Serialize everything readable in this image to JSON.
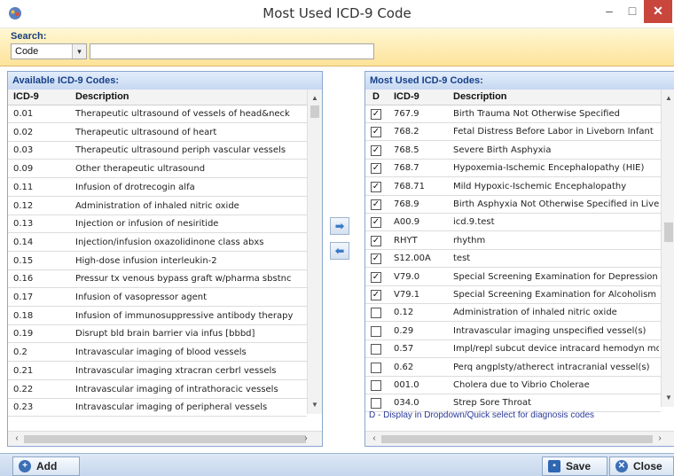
{
  "window": {
    "title": "Most Used ICD-9 Code",
    "minimize": "–",
    "maximize": "□",
    "close": "✕"
  },
  "search": {
    "label": "Search:",
    "field_value": "Code",
    "dropdown_arrow": "▾",
    "input_value": ""
  },
  "available": {
    "title": "Available ICD-9 Codes:",
    "col_code": "ICD-9",
    "col_desc": "Description",
    "rows": [
      {
        "code": "0.01",
        "desc": "Therapeutic ultrasound of vessels of head&neck"
      },
      {
        "code": "0.02",
        "desc": "Therapeutic ultrasound of heart"
      },
      {
        "code": "0.03",
        "desc": "Therapeutic ultrasound periph vascular vessels"
      },
      {
        "code": "0.09",
        "desc": "Other therapeutic ultrasound"
      },
      {
        "code": "0.11",
        "desc": "Infusion of drotrecogin alfa"
      },
      {
        "code": "0.12",
        "desc": "Administration of inhaled nitric oxide"
      },
      {
        "code": "0.13",
        "desc": "Injection or infusion of nesiritide"
      },
      {
        "code": "0.14",
        "desc": "Injection/infusion oxazolidinone class abxs"
      },
      {
        "code": "0.15",
        "desc": "High-dose infusion interleukin-2"
      },
      {
        "code": "0.16",
        "desc": "Pressur tx venous bypass graft w/pharma sbstnc"
      },
      {
        "code": "0.17",
        "desc": "Infusion of vasopressor agent"
      },
      {
        "code": "0.18",
        "desc": "Infusion of immunosuppressive antibody therapy"
      },
      {
        "code": "0.19",
        "desc": "Disrupt bld brain barrier via infus [bbbd]"
      },
      {
        "code": "0.2",
        "desc": "Intravascular imaging of blood vessels"
      },
      {
        "code": "0.21",
        "desc": "Intravascular imaging xtracran cerbrl vessels"
      },
      {
        "code": "0.22",
        "desc": "Intravascular imaging of intrathoracic vessels"
      },
      {
        "code": "0.23",
        "desc": "Intravascular imaging of peripheral vessels"
      }
    ]
  },
  "most_used": {
    "title": "Most Used ICD-9 Codes:",
    "col_d": "D",
    "col_code": "ICD-9",
    "col_desc": "Description",
    "rows": [
      {
        "checked": true,
        "code": "767.9",
        "desc": "Birth Trauma Not Otherwise Specified"
      },
      {
        "checked": true,
        "code": "768.2",
        "desc": "Fetal Distress Before Labor in Liveborn Infant"
      },
      {
        "checked": true,
        "code": "768.5",
        "desc": "Severe Birth Asphyxia"
      },
      {
        "checked": true,
        "code": "768.7",
        "desc": "Hypoxemia-Ischemic Encephalopathy (HIE)"
      },
      {
        "checked": true,
        "code": "768.71",
        "desc": "Mild Hypoxic-Ischemic Encephalopathy"
      },
      {
        "checked": true,
        "code": "768.9",
        "desc": "Birth Asphyxia Not Otherwise Specified in Liveborn In"
      },
      {
        "checked": true,
        "code": "A00.9",
        "desc": "icd.9.test"
      },
      {
        "checked": true,
        "code": "RHYT",
        "desc": "rhythm"
      },
      {
        "checked": true,
        "code": "S12.00A",
        "desc": "test"
      },
      {
        "checked": true,
        "code": "V79.0",
        "desc": "Special Screening Examination for Depression"
      },
      {
        "checked": true,
        "code": "V79.1",
        "desc": "Special Screening Examination for Alcoholism"
      },
      {
        "checked": false,
        "code": "0.12",
        "desc": "Administration of inhaled nitric oxide"
      },
      {
        "checked": false,
        "code": "0.29",
        "desc": "Intravascular imaging unspecified vessel(s)"
      },
      {
        "checked": false,
        "code": "0.57",
        "desc": "Impl/repl subcut device intracard hemodyn mon"
      },
      {
        "checked": false,
        "code": "0.62",
        "desc": "Perq angplsty/atherect intracranial vessel(s)"
      },
      {
        "checked": false,
        "code": "001.0",
        "desc": "Cholera due to Vibrio Cholerae"
      },
      {
        "checked": false,
        "code": "034.0",
        "desc": "Strep Sore Throat"
      }
    ],
    "footnote": "D - Display in Dropdown/Quick select for diagnosis codes"
  },
  "actions": {
    "move_right": "➡",
    "move_left": "⬅",
    "add": "Add",
    "save": "Save",
    "close": "Close"
  },
  "icons": {
    "add": "plus-circle-icon",
    "save": "floppy-disk-icon",
    "close": "close-circle-icon"
  }
}
